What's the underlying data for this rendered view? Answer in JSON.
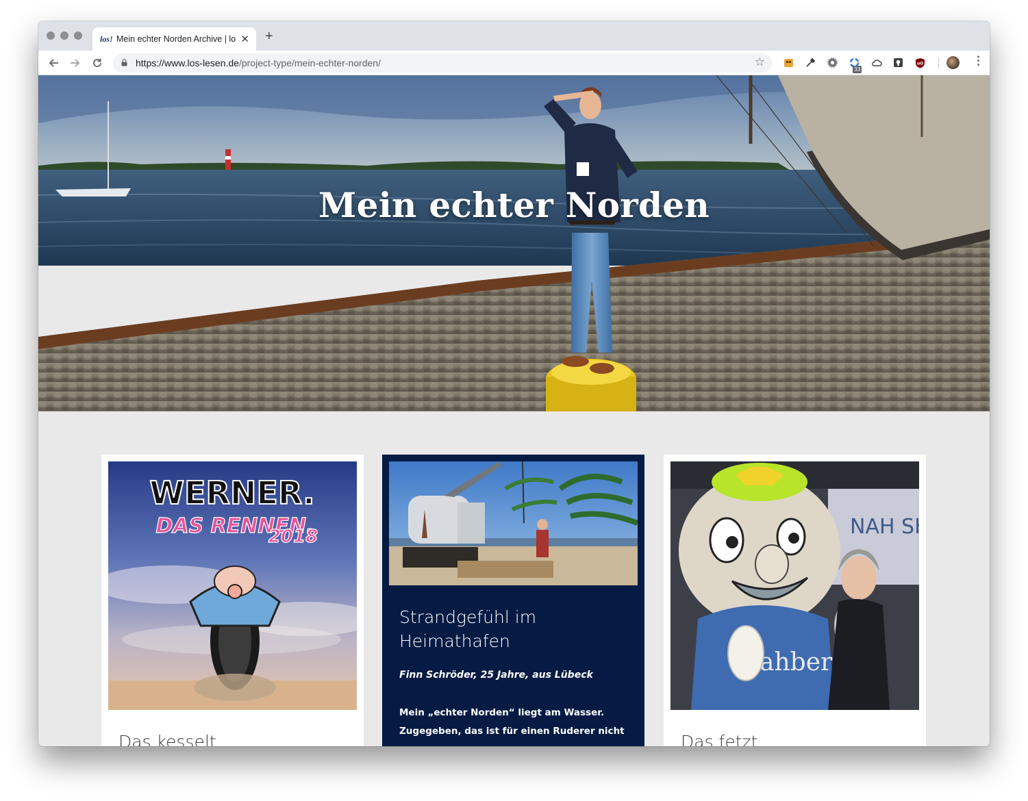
{
  "browser": {
    "tab_title": "Mein echter Norden Archive | lo",
    "tab_favicon_text": "los!",
    "new_tab_symbol": "+",
    "close_symbol": "✕",
    "url_host": "https://www.los-lesen.de",
    "url_path": "/project-type/mein-echter-norden/",
    "extension_badge": "33",
    "accent_color": "#1a73e8"
  },
  "hero": {
    "title": "Mein echter Norden",
    "image": "harbour-quay-man-on-bollard"
  },
  "cards": [
    {
      "title": "Das kesselt",
      "image": "werner-das-rennen-2018-poster",
      "image_text_top": "WERNER.",
      "image_text_mid": "DAS RENNEN.",
      "image_text_year": "2018"
    },
    {
      "title": "Strandgefühl im Heimathafen",
      "subtitle": "Finn Schröder, 25 Jahre, aus Lübeck",
      "text": "Mein „echter Norden“ liegt am Wasser. Zugegeben, das ist für einen Ruderer nicht",
      "image": "man-sitting-on-pallets-by-crane"
    },
    {
      "title": "Das fetzt",
      "image": "mascot-costume-with-woman",
      "image_text_sign": "NAH SH",
      "image_text_shirt": "ahber"
    }
  ],
  "colors": {
    "page_background": "#e9e9ea",
    "card_dark": "#061b43"
  }
}
